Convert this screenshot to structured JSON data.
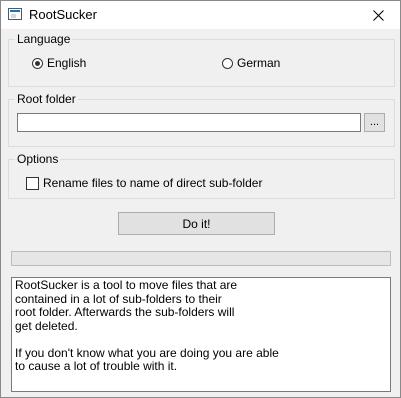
{
  "window": {
    "title": "RootSucker",
    "icon": "app-window-icon",
    "close_icon": "close-icon"
  },
  "language": {
    "legend": "Language",
    "options": [
      {
        "label": "English",
        "selected": true
      },
      {
        "label": "German",
        "selected": false
      }
    ]
  },
  "root_folder": {
    "legend": "Root folder",
    "value": "",
    "browse_label": "..."
  },
  "options": {
    "legend": "Options",
    "rename_label": "Rename files to name of direct sub-folder",
    "rename_checked": false
  },
  "action": {
    "do_label": "Do it!"
  },
  "progress": {
    "value": 0
  },
  "description": {
    "text": "RootSucker is a tool to move files that are\ncontained in a lot of sub-folders to their\nroot folder. Afterwards the sub-folders will\nget deleted.\n\nIf you don't know what you are doing you are able\nto cause a lot of trouble with it."
  }
}
